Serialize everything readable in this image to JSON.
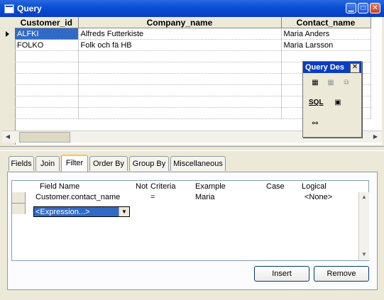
{
  "window": {
    "title": "Query"
  },
  "grid": {
    "columns": [
      "Customer_id",
      "Company_name",
      "Contact_name"
    ],
    "rows": [
      [
        "ALFKI",
        "Alfreds Futterkiste",
        "Maria Anders"
      ],
      [
        "FOLKO",
        "Folk och fä HB",
        "Maria Larsson"
      ]
    ]
  },
  "palette": {
    "title": "Query Des",
    "close": "✕"
  },
  "tabs": [
    "Fields",
    "Join",
    "Filter",
    "Order By",
    "Group By",
    "Miscellaneous"
  ],
  "filter": {
    "headers": {
      "field_name": "Field Name",
      "not": "Not",
      "criteria": "Criteria",
      "example": "Example",
      "case": "Case",
      "logical": "Logical"
    },
    "row": {
      "field_name": "Customer.contact_name",
      "criteria": "=",
      "example": "Maria",
      "logical": "<None>"
    },
    "expression_select": "<Expression...>"
  },
  "buttons": {
    "insert": "Insert",
    "remove": "Remove"
  }
}
